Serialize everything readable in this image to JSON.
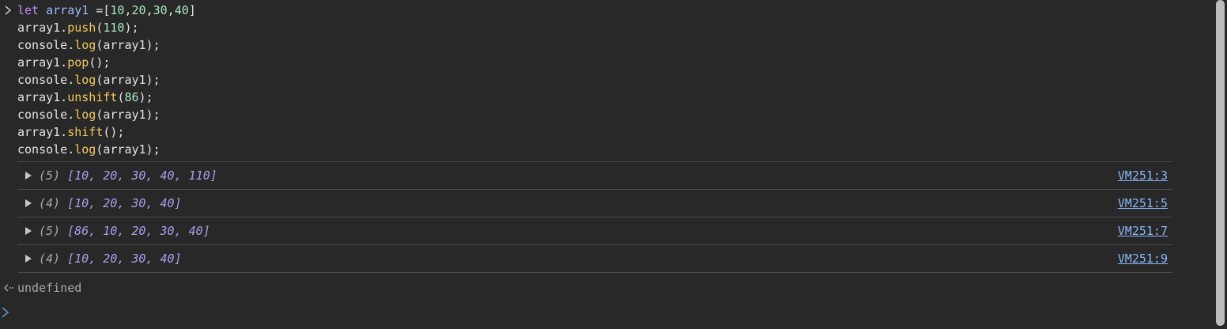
{
  "input": {
    "lines": [
      [
        {
          "t": "let ",
          "c": "kw"
        },
        {
          "t": "array1 ",
          "c": "var"
        },
        {
          "t": "=[",
          "c": "plain"
        },
        {
          "t": "10",
          "c": "num"
        },
        {
          "t": ",",
          "c": "plain"
        },
        {
          "t": "20",
          "c": "num"
        },
        {
          "t": ",",
          "c": "plain"
        },
        {
          "t": "30",
          "c": "num"
        },
        {
          "t": ",",
          "c": "plain"
        },
        {
          "t": "40",
          "c": "num"
        },
        {
          "t": "]",
          "c": "plain"
        }
      ],
      [
        {
          "t": "array1.",
          "c": "plain"
        },
        {
          "t": "push",
          "c": "fn"
        },
        {
          "t": "(",
          "c": "plain"
        },
        {
          "t": "110",
          "c": "num"
        },
        {
          "t": ");",
          "c": "plain"
        }
      ],
      [
        {
          "t": "console.",
          "c": "plain"
        },
        {
          "t": "log",
          "c": "fn"
        },
        {
          "t": "(array1);",
          "c": "plain"
        }
      ],
      [
        {
          "t": "array1.",
          "c": "plain"
        },
        {
          "t": "pop",
          "c": "fn"
        },
        {
          "t": "();",
          "c": "plain"
        }
      ],
      [
        {
          "t": "console.",
          "c": "plain"
        },
        {
          "t": "log",
          "c": "fn"
        },
        {
          "t": "(array1);",
          "c": "plain"
        }
      ],
      [
        {
          "t": "array1.",
          "c": "plain"
        },
        {
          "t": "unshift",
          "c": "fn"
        },
        {
          "t": "(",
          "c": "plain"
        },
        {
          "t": "86",
          "c": "num"
        },
        {
          "t": ");",
          "c": "plain"
        }
      ],
      [
        {
          "t": "console.",
          "c": "plain"
        },
        {
          "t": "log",
          "c": "fn"
        },
        {
          "t": "(array1);",
          "c": "plain"
        }
      ],
      [
        {
          "t": "array1.",
          "c": "plain"
        },
        {
          "t": "shift",
          "c": "fn"
        },
        {
          "t": "();",
          "c": "plain"
        }
      ],
      [
        {
          "t": "console.",
          "c": "plain"
        },
        {
          "t": "log",
          "c": "fn"
        },
        {
          "t": "(array1);",
          "c": "plain"
        }
      ]
    ]
  },
  "logs": [
    {
      "count": "(5)",
      "array": "[10, 20, 30, 40, 110]",
      "source": "VM251:3"
    },
    {
      "count": "(4)",
      "array": "[10, 20, 30, 40]",
      "source": "VM251:5"
    },
    {
      "count": "(5)",
      "array": "[86, 10, 20, 30, 40]",
      "source": "VM251:7"
    },
    {
      "count": "(4)",
      "array": "[10, 20, 30, 40]",
      "source": "VM251:9"
    }
  ],
  "result": {
    "text": "undefined"
  },
  "icons": {
    "prompt": "chevron-right-icon",
    "expand": "triangle-right-icon",
    "result": "return-arrow-icon"
  },
  "colors": {
    "background": "#282828",
    "keyword": "#c58af9",
    "variable": "#9cb8ff",
    "number": "#a8e8c0",
    "function": "#f3c95b",
    "array_value": "#a6a0ee",
    "link": "#8ab4f8",
    "prompt_blue": "#6b8fd6"
  }
}
